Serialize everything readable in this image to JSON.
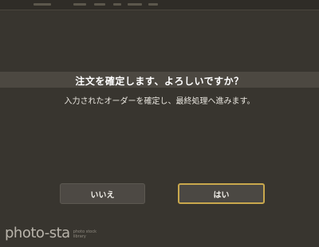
{
  "dialog": {
    "title": "注文を確定します、よろしいですか？",
    "message": "入力されたオーダーを確定し、最終処理へ進みます。",
    "cancel_label": "いいえ",
    "confirm_label": "はい"
  },
  "watermark": {
    "brand": "photo-sta",
    "line1": "photo stock",
    "line2": "library"
  },
  "colors": {
    "background": "#38352f",
    "title_band": "#4c4841",
    "button": "#4d4944",
    "focus_border": "#c9a84d"
  }
}
